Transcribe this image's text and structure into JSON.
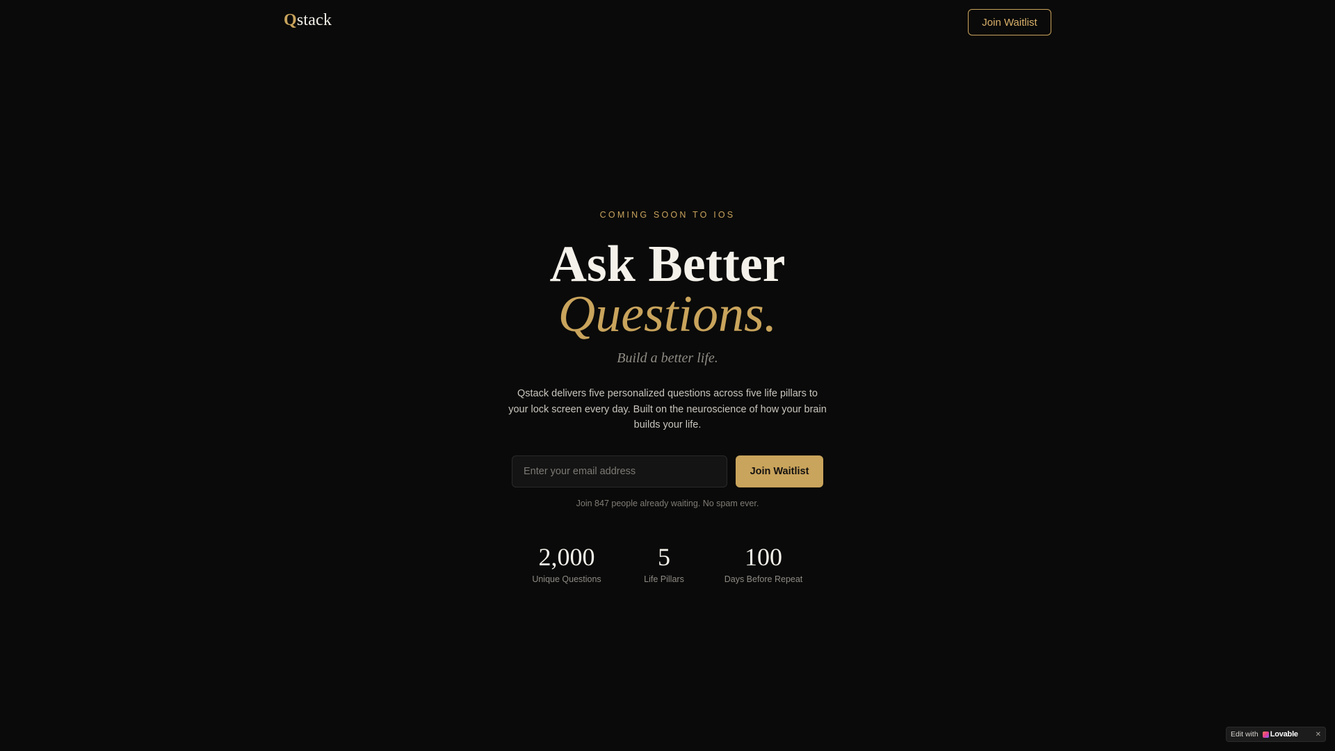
{
  "header": {
    "logo_initial": "Q",
    "logo_rest": "stack",
    "cta_label": "Join Waitlist"
  },
  "hero": {
    "eyebrow": "COMING SOON TO IOS",
    "title_line1": "Ask Better",
    "title_line2": "Questions.",
    "subtitle": "Build a better life.",
    "description": "Qstack delivers five personalized questions across five life pillars to your lock screen every day. Built on the neuroscience of how your brain builds your life."
  },
  "form": {
    "email_placeholder": "Enter your email address",
    "email_value": "",
    "submit_label": "Join Waitlist",
    "note": "Join 847 people already waiting. No spam ever."
  },
  "stats": [
    {
      "value": "2,000",
      "label": "Unique Questions"
    },
    {
      "value": "5",
      "label": "Life Pillars"
    },
    {
      "value": "100",
      "label": "Days Before Repeat"
    }
  ],
  "badge": {
    "prefix": "Edit with",
    "brand": "Lovable",
    "close_glyph": "✕"
  },
  "colors": {
    "background": "#0a0a0a",
    "accent_gold": "#c9a45c",
    "text_primary": "#f4f1ea",
    "text_muted": "#8f8b84"
  }
}
